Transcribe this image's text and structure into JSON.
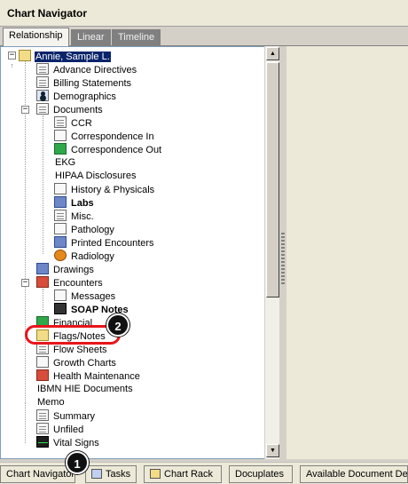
{
  "window": {
    "title": "Chart Navigator"
  },
  "tabs": [
    {
      "label": "Relationship",
      "active": true
    },
    {
      "label": "Linear",
      "active": false
    },
    {
      "label": "Timeline",
      "active": false
    }
  ],
  "tree": {
    "root": "Annie, Sample L.",
    "items": [
      {
        "label": "Advance Directives",
        "icon": "document-icon"
      },
      {
        "label": "Billing Statements",
        "icon": "document-icon"
      },
      {
        "label": "Demographics",
        "icon": "person-icon"
      },
      {
        "label": "Documents",
        "icon": "document-icon",
        "expanded": true
      },
      {
        "label": "CCR",
        "icon": "document-icon"
      },
      {
        "label": "Correspondence In",
        "icon": "envelope-in-icon"
      },
      {
        "label": "Correspondence Out",
        "icon": "envelope-out-icon"
      },
      {
        "label": "EKG",
        "icon": "none"
      },
      {
        "label": "HIPAA Disclosures",
        "icon": "none"
      },
      {
        "label": "History & Physicals",
        "icon": "stethoscope-icon"
      },
      {
        "label": "Labs",
        "icon": "flask-icon",
        "bold": true
      },
      {
        "label": "Misc.",
        "icon": "document-icon"
      },
      {
        "label": "Pathology",
        "icon": "microscope-icon"
      },
      {
        "label": "Printed Encounters",
        "icon": "printer-icon"
      },
      {
        "label": "Radiology",
        "icon": "radiation-icon"
      },
      {
        "label": "Drawings",
        "icon": "hand-icon"
      },
      {
        "label": "Encounters",
        "icon": "clipboard-icon",
        "expanded": true
      },
      {
        "label": "Messages",
        "icon": "phone-icon"
      },
      {
        "label": "SOAP Notes",
        "icon": "notes-icon",
        "bold": true
      },
      {
        "label": "Financial",
        "icon": "money-icon"
      },
      {
        "label": "Flags/Notes",
        "icon": "pencil-icon"
      },
      {
        "label": "Flow Sheets",
        "icon": "document-icon"
      },
      {
        "label": "Growth Charts",
        "icon": "chart-icon"
      },
      {
        "label": "Health Maintenance",
        "icon": "health-icon"
      },
      {
        "label": "IBMN HIE Documents",
        "icon": "none"
      },
      {
        "label": "Memo",
        "icon": "none"
      },
      {
        "label": "Summary",
        "icon": "document-icon"
      },
      {
        "label": "Unfiled",
        "icon": "document-icon"
      },
      {
        "label": "Vital Signs",
        "icon": "vitals-icon"
      }
    ]
  },
  "annotations": {
    "marker1": "1",
    "marker2": "2"
  },
  "taskbar": {
    "items": [
      {
        "label": "Chart Navigator"
      },
      {
        "label": "Tasks"
      },
      {
        "label": "Chart Rack"
      },
      {
        "label": "Docuplates"
      },
      {
        "label": "Available Document De"
      }
    ]
  },
  "colors": {
    "selection": "#0a246a",
    "highlight_ring": "#e8151b"
  }
}
